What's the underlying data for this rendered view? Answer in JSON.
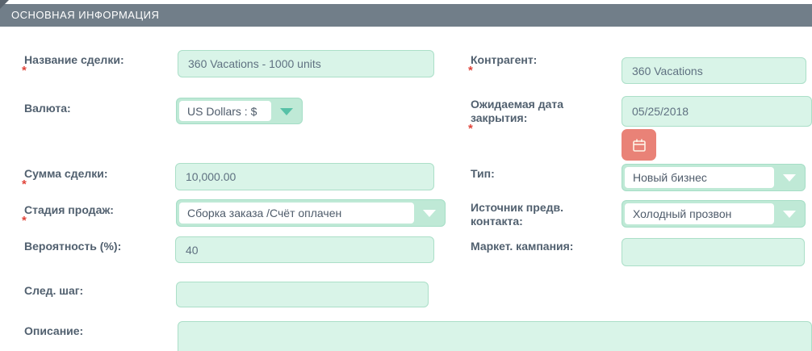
{
  "ui": {
    "required_marker": "*"
  },
  "panel": {
    "title": "ОСНОВНАЯ ИНФОРМАЦИЯ"
  },
  "colors": {
    "header_bg": "#717E89",
    "field_bg": "#D9F4E8",
    "field_border": "#ABDFC8",
    "dropdown_shell": "#BFE9D6",
    "accent_teal": "#57C1A7",
    "calendar_button": "#E98277",
    "label_text": "#51606F",
    "required_red": "#E0443A"
  },
  "fields": {
    "deal_name": {
      "label": "Название сделки:",
      "value": "360 Vacations - 1000 units",
      "required": true
    },
    "currency": {
      "label": "Валюта:",
      "value": "US Dollars : $",
      "required": false
    },
    "amount": {
      "label": "Сумма сделки:",
      "value": "10,000.00",
      "required": true
    },
    "sales_stage": {
      "label": "Стадия продаж:",
      "value": "Сборка заказа /Счёт оплачен",
      "required": true
    },
    "probability": {
      "label": "Вероятность (%):",
      "value": "40",
      "required": false
    },
    "next_step": {
      "label": "След. шаг:",
      "value": "",
      "required": false
    },
    "description": {
      "label": "Описание:",
      "value": "",
      "required": false
    },
    "account": {
      "label": "Контрагент:",
      "value": "360 Vacations",
      "required": true
    },
    "close_date": {
      "label": "Ожидаемая дата закрытия:",
      "value": "05/25/2018",
      "required": true
    },
    "type": {
      "label": "Тип:",
      "value": "Новый бизнес",
      "required": false
    },
    "lead_source": {
      "label": "Источник предв. контакта:",
      "value": "Холодный прозвон",
      "required": false
    },
    "campaign": {
      "label": "Маркет. кампания:",
      "value": "",
      "required": false
    }
  }
}
